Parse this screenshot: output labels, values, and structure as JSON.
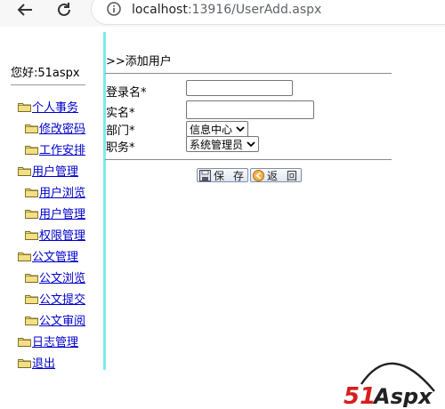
{
  "browser": {
    "url_host": "localhost",
    "url_rest": ":13916/UserAdd.aspx"
  },
  "sidebar": {
    "greeting": "您好:51aspx",
    "items": [
      {
        "label": "个人事务",
        "level": 0
      },
      {
        "label": "修改密码",
        "level": 1
      },
      {
        "label": "工作安排",
        "level": 1
      },
      {
        "label": "用户管理",
        "level": 0
      },
      {
        "label": "用户浏览",
        "level": 1
      },
      {
        "label": "用户管理",
        "level": 1
      },
      {
        "label": "权限管理",
        "level": 1
      },
      {
        "label": "公文管理",
        "level": 0
      },
      {
        "label": "公文浏览",
        "level": 1
      },
      {
        "label": "公文提交",
        "level": 1
      },
      {
        "label": "公文审阅",
        "level": 1
      },
      {
        "label": "日志管理",
        "level": 0
      },
      {
        "label": "退出",
        "level": 0
      }
    ]
  },
  "main": {
    "breadcrumb": ">>添加用户",
    "form": {
      "login_label": "登录名*",
      "login_value": "",
      "realname_label": "实名*",
      "realname_value": "",
      "dept_label": "部门*",
      "dept_selected": "信息中心",
      "role_label": "职务*",
      "role_selected": "系统管理员"
    },
    "save_label": "保 存",
    "back_label": "返 回"
  },
  "logo_text": "51Aspx",
  "colors": {
    "divider": "#7fe8ee",
    "link": "#0000cc",
    "logo_red": "#d71e1e"
  }
}
